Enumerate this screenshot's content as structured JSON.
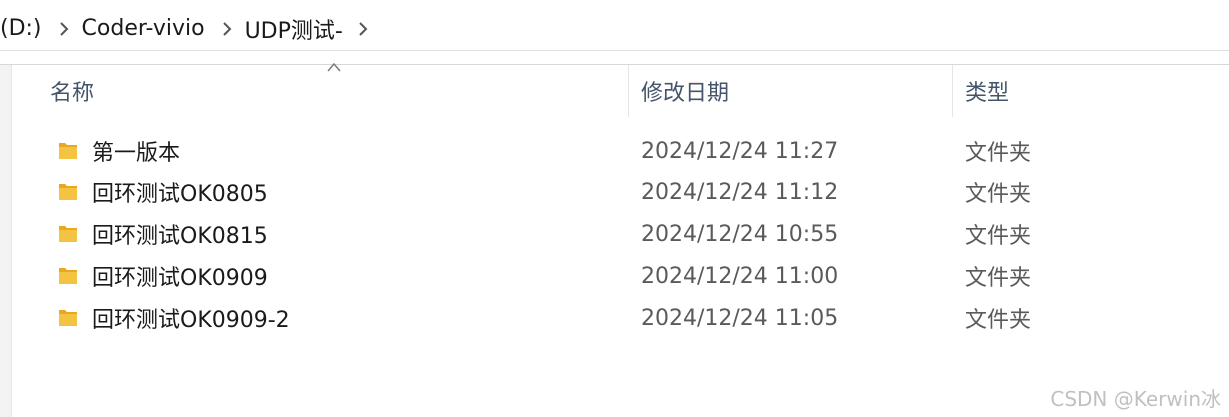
{
  "breadcrumb": {
    "items": [
      "(D:)",
      "Coder-vivio",
      "UDP测试-"
    ]
  },
  "columns": {
    "name": "名称",
    "date": "修改日期",
    "type": "类型"
  },
  "rows": [
    {
      "name": "第一版本",
      "date": "2024/12/24 11:27",
      "type": "文件夹"
    },
    {
      "name": "回环测试OK0805",
      "date": "2024/12/24 11:12",
      "type": "文件夹"
    },
    {
      "name": "回环测试OK0815",
      "date": "2024/12/24 10:55",
      "type": "文件夹"
    },
    {
      "name": "回环测试OK0909",
      "date": "2024/12/24 11:00",
      "type": "文件夹"
    },
    {
      "name": "回环测试OK0909-2",
      "date": "2024/12/24 11:05",
      "type": "文件夹"
    }
  ],
  "watermark": "CSDN @Kerwin冰",
  "colors": {
    "folder": "#f5c342",
    "header_text": "#44546a",
    "secondary_text": "#5a5a5a"
  },
  "icons": {
    "folder": "folder-icon",
    "chevron": "chevron-right-icon",
    "sort": "sort-ascending-icon"
  }
}
